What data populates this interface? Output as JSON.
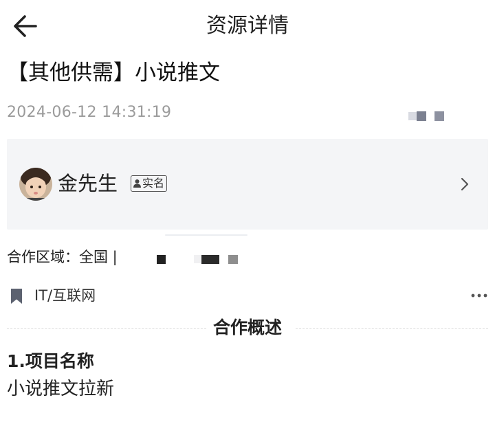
{
  "header": {
    "title": "资源详情",
    "back_icon": "arrow-left-icon"
  },
  "resource": {
    "title": "【其他供需】小说推文",
    "timestamp": "2024-06-12 14:31:19"
  },
  "user": {
    "name": "金先生",
    "badge": "实名",
    "avatar": "child-photo-avatar",
    "chevron_icon": "chevron-right-icon"
  },
  "details": {
    "region": "合作区域：全国 |",
    "industry": "IT/互联网",
    "industry_icon": "bookmark-icon",
    "more_icon": "more-dots-icon"
  },
  "overview": {
    "section_title": "合作概述",
    "item_heading": "1.项目名称",
    "item_value": "小说推文拉新"
  },
  "colors": {
    "text_primary": "#222222",
    "text_secondary": "#9b9b9b",
    "card_background": "#f4f5f7",
    "icon_gray": "#5c6270"
  }
}
